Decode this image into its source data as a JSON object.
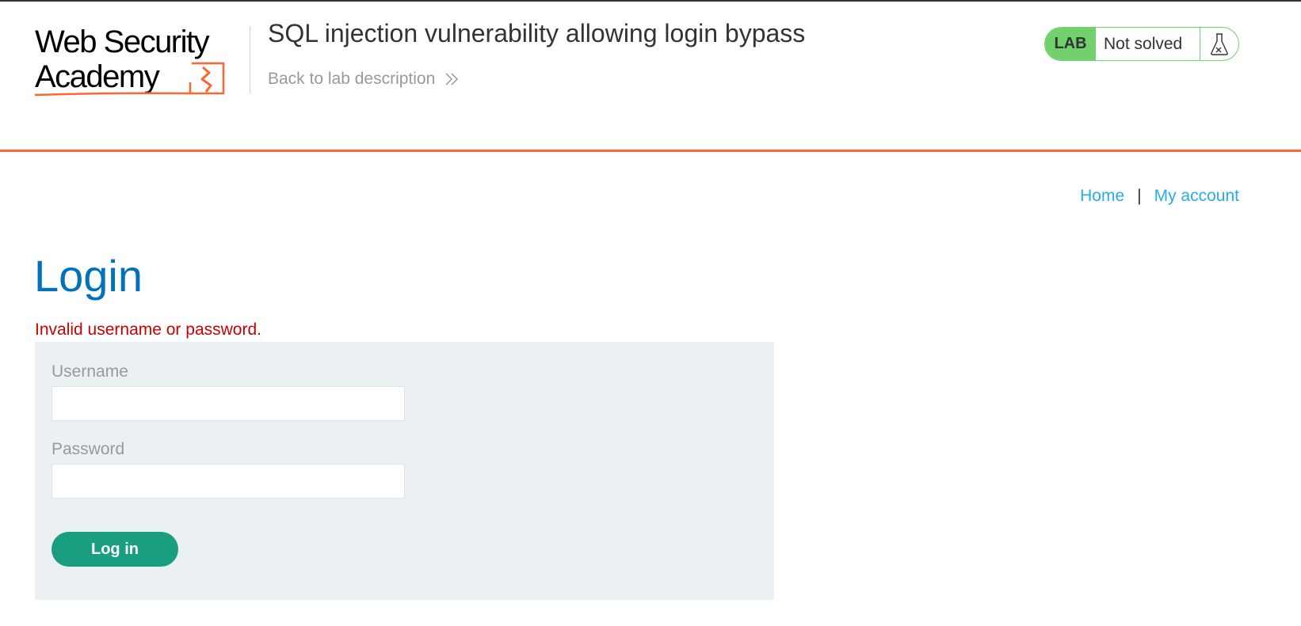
{
  "header": {
    "logo_text": "Web Security Academy",
    "lab_title": "SQL injection vulnerability allowing login bypass",
    "back_link": "Back to lab description",
    "back_icon": "double-chevron-right-icon"
  },
  "status": {
    "badge": "LAB",
    "text": "Not solved",
    "icon": "flask-icon",
    "color": "#70d16d"
  },
  "nav": {
    "home": "Home",
    "separator": "|",
    "account": "My account"
  },
  "main": {
    "title": "Login",
    "error": "Invalid username or password.",
    "username_label": "Username",
    "username_value": "",
    "password_label": "Password",
    "password_value": "",
    "submit_label": "Log in"
  },
  "colors": {
    "accent_orange": "#ff6633",
    "title_blue": "#0071bc",
    "link_blue": "#29ace5",
    "error_red": "#cc0000",
    "button_green": "#1a9e80",
    "form_bg": "#ebf0f2"
  }
}
